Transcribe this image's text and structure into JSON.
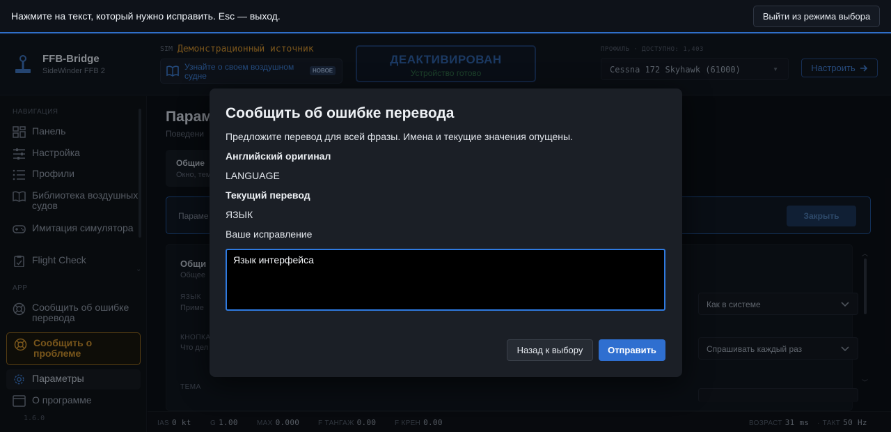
{
  "banner": {
    "message": "Нажмите на текст, который нужно исправить. Esc — выход.",
    "exit_label": "Выйти из режима выбора"
  },
  "header": {
    "brand_title": "FFB-Bridge",
    "brand_subtitle": "SideWinder FFB 2",
    "sim_tag": "SIM",
    "sim_source": "Демонстрационный источник",
    "learn_text": "Узнайте о своем воздушном судне",
    "new_badge": "НОВОЕ",
    "status_title": "ДЕАКТИВИРОВАН",
    "status_subtitle": "Устройство готово",
    "profile_label": "ПРОФИЛЬ · ДОСТУПНО: 1,403",
    "profile_value": "Cessna 172 Skyhawk (61000)",
    "setup_label": "Настроить"
  },
  "sidebar": {
    "nav_heading": "НАВИГАЦИЯ",
    "items": [
      {
        "label": "Панель",
        "icon": "dashboard-icon"
      },
      {
        "label": "Настройка",
        "icon": "sliders-icon"
      },
      {
        "label": "Профили",
        "icon": "list-icon"
      },
      {
        "label": "Библиотека воздушных судов",
        "icon": "book-icon"
      },
      {
        "label": "Имитация симулятора",
        "icon": "gamepad-icon"
      },
      {
        "label": "Flight Check",
        "icon": "clipboard-icon"
      }
    ],
    "app_heading": "APP",
    "app_items": [
      {
        "label": "Сообщить об ошибке перевода",
        "icon": "lifebuoy-icon"
      },
      {
        "label": "Сообщить о проблеме",
        "icon": "lifebuoy-icon"
      },
      {
        "label": "Параметры",
        "icon": "gear-icon"
      },
      {
        "label": "О программе",
        "icon": "window-icon"
      }
    ],
    "version": "1.6.0"
  },
  "main": {
    "page_title": "Парам",
    "page_subtitle": "Поведени",
    "tab_title": "Общие",
    "tab_sub": "Окно, тем",
    "info_text": "Параме",
    "close_label": "Закрыть",
    "section_title": "Общи",
    "section_sub": "Общее",
    "rows": [
      {
        "label": "ЯЗЫК",
        "desc": "Приме",
        "value": "Как в системе"
      },
      {
        "label": "КНОПКА",
        "desc": "Что дел",
        "value": "Спрашивать каждый раз"
      },
      {
        "label": "ТЕМА",
        "desc": "",
        "value": ""
      }
    ]
  },
  "footer": {
    "ias_label": "IAS",
    "ias_value": "0 kt",
    "g_label": "G",
    "g_value": "1.00",
    "max_label": "MAX",
    "max_value": "0.000",
    "pitch_label": "F ТАНГАЖ",
    "pitch_value": "0.00",
    "roll_label": "F КРЕН",
    "roll_value": "0.00",
    "age_label": "ВОЗРАСТ",
    "age_value": "31 ms",
    "tick_label": "ТАКТ",
    "tick_value": "50 Hz"
  },
  "modal": {
    "title": "Сообщить об ошибке перевода",
    "description": "Предложите перевод для всей фразы. Имена и текущие значения опущены.",
    "original_heading": "Английский оригинал",
    "original_value": "LANGUAGE",
    "current_heading": "Текущий перевод",
    "current_value": "ЯЗЫК",
    "fix_label": "Ваше исправление",
    "fix_value": "Язык интерфейса",
    "back_label": "Назад к выбору",
    "send_label": "Отправить"
  },
  "colors": {
    "accent_blue": "#2f6fd0",
    "warning_amber": "#c38b2c",
    "ready_green": "#2e6a44"
  }
}
